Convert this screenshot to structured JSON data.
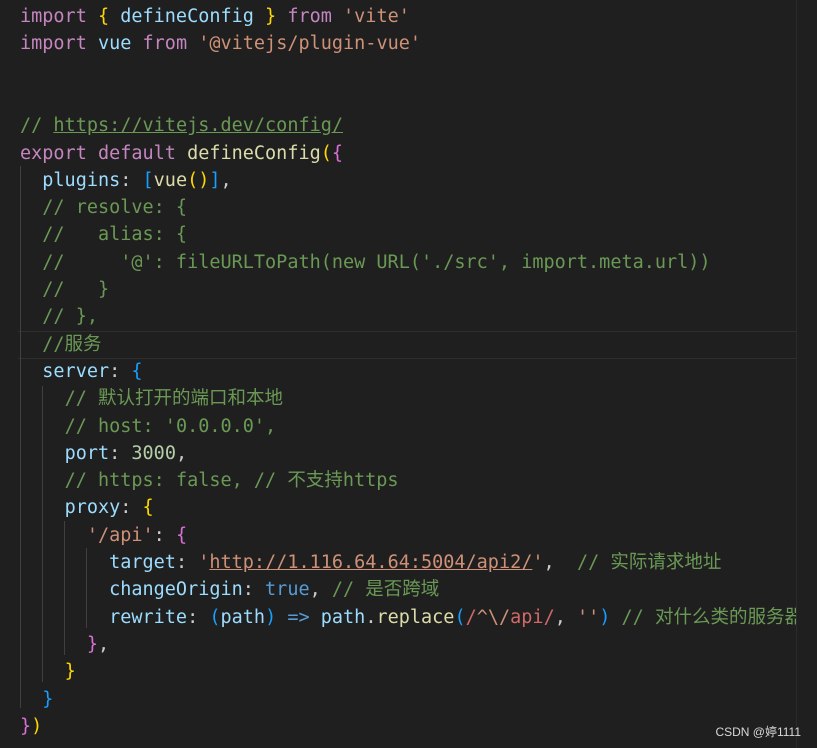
{
  "editor": {
    "lines": [
      [
        {
          "t": "import",
          "c": "kw"
        },
        {
          "t": " "
        },
        {
          "t": "{",
          "c": "b1"
        },
        {
          "t": " defineConfig ",
          "c": "prop"
        },
        {
          "t": "}",
          "c": "b1"
        },
        {
          "t": " "
        },
        {
          "t": "from",
          "c": "kw"
        },
        {
          "t": " "
        },
        {
          "t": "'vite'",
          "c": "str"
        }
      ],
      [
        {
          "t": "import",
          "c": "kw"
        },
        {
          "t": " "
        },
        {
          "t": "vue",
          "c": "prop"
        },
        {
          "t": " "
        },
        {
          "t": "from",
          "c": "kw"
        },
        {
          "t": " "
        },
        {
          "t": "'@vitejs/plugin-vue'",
          "c": "str"
        }
      ],
      [],
      [],
      [
        {
          "t": "// ",
          "c": "cmt"
        },
        {
          "t": "https://vitejs.dev/config/",
          "c": "cmt link"
        }
      ],
      [
        {
          "t": "export",
          "c": "kw"
        },
        {
          "t": " "
        },
        {
          "t": "default",
          "c": "kw"
        },
        {
          "t": " "
        },
        {
          "t": "defineConfig",
          "c": "fn"
        },
        {
          "t": "(",
          "c": "b1"
        },
        {
          "t": "{",
          "c": "b2"
        }
      ],
      [
        {
          "t": "  "
        },
        {
          "t": "plugins",
          "c": "prop"
        },
        {
          "t": ": "
        },
        {
          "t": "[",
          "c": "b3"
        },
        {
          "t": "vue",
          "c": "fn"
        },
        {
          "t": "()",
          "c": "b1"
        },
        {
          "t": "]",
          "c": "b3"
        },
        {
          "t": ","
        }
      ],
      [
        {
          "t": "  "
        },
        {
          "t": "// resolve: {",
          "c": "cmt"
        }
      ],
      [
        {
          "t": "  "
        },
        {
          "t": "//   alias: {",
          "c": "cmt"
        }
      ],
      [
        {
          "t": "  "
        },
        {
          "t": "//     '@': fileURLToPath(new URL('./src', import.meta.url))",
          "c": "cmt"
        }
      ],
      [
        {
          "t": "  "
        },
        {
          "t": "//   }",
          "c": "cmt"
        }
      ],
      [
        {
          "t": "  "
        },
        {
          "t": "// },",
          "c": "cmt"
        }
      ],
      [
        {
          "t": "  "
        },
        {
          "t": "//服务",
          "c": "cmt"
        }
      ],
      [
        {
          "t": "  "
        },
        {
          "t": "server",
          "c": "prop"
        },
        {
          "t": ": "
        },
        {
          "t": "{",
          "c": "b3"
        }
      ],
      [
        {
          "t": "    "
        },
        {
          "t": "// 默认打开的端口和本地",
          "c": "cmt"
        }
      ],
      [
        {
          "t": "    "
        },
        {
          "t": "// host: '0.0.0.0',",
          "c": "cmt"
        }
      ],
      [
        {
          "t": "    "
        },
        {
          "t": "port",
          "c": "prop"
        },
        {
          "t": ": "
        },
        {
          "t": "3000",
          "c": "num"
        },
        {
          "t": ","
        }
      ],
      [
        {
          "t": "    "
        },
        {
          "t": "// https: false, // 不支持https",
          "c": "cmt"
        }
      ],
      [
        {
          "t": "    "
        },
        {
          "t": "proxy",
          "c": "prop"
        },
        {
          "t": ": "
        },
        {
          "t": "{",
          "c": "b1"
        }
      ],
      [
        {
          "t": "      "
        },
        {
          "t": "'/api'",
          "c": "str"
        },
        {
          "t": ": "
        },
        {
          "t": "{",
          "c": "b2"
        }
      ],
      [
        {
          "t": "        "
        },
        {
          "t": "target",
          "c": "prop"
        },
        {
          "t": ": "
        },
        {
          "t": "'",
          "c": "str"
        },
        {
          "t": "http://1.116.64.64:5004/api2/",
          "c": "str link"
        },
        {
          "t": "'",
          "c": "str"
        },
        {
          "t": ",  "
        },
        {
          "t": "// 实际请求地址",
          "c": "cmt"
        }
      ],
      [
        {
          "t": "        "
        },
        {
          "t": "changeOrigin",
          "c": "prop"
        },
        {
          "t": ": "
        },
        {
          "t": "true",
          "c": "kb"
        },
        {
          "t": ", "
        },
        {
          "t": "// 是否跨域",
          "c": "cmt"
        }
      ],
      [
        {
          "t": "        "
        },
        {
          "t": "rewrite",
          "c": "prop"
        },
        {
          "t": ": "
        },
        {
          "t": "(",
          "c": "b3"
        },
        {
          "t": "path",
          "c": "prop"
        },
        {
          "t": ")",
          "c": "b3"
        },
        {
          "t": " "
        },
        {
          "t": "=>",
          "c": "kb"
        },
        {
          "t": " "
        },
        {
          "t": "path",
          "c": "prop"
        },
        {
          "t": "."
        },
        {
          "t": "replace",
          "c": "fn"
        },
        {
          "t": "(",
          "c": "b3"
        },
        {
          "t": "/",
          "c": "rx"
        },
        {
          "t": "^\\/",
          "c": "str"
        },
        {
          "t": "api",
          "c": "rx"
        },
        {
          "t": "/",
          "c": "rx"
        },
        {
          "t": ", "
        },
        {
          "t": "''",
          "c": "str"
        },
        {
          "t": ")",
          "c": "b3"
        },
        {
          "t": " "
        },
        {
          "t": "// 对什么类的服务器",
          "c": "cmt"
        }
      ],
      [
        {
          "t": "      "
        },
        {
          "t": "}",
          "c": "b2"
        },
        {
          "t": ","
        }
      ],
      [
        {
          "t": "    "
        },
        {
          "t": "}",
          "c": "b1"
        }
      ],
      [
        {
          "t": "  "
        },
        {
          "t": "}",
          "c": "b3"
        }
      ],
      [
        {
          "t": "}",
          "c": "b2"
        },
        {
          "t": ")",
          "c": "b1"
        }
      ]
    ]
  },
  "watermark": "CSDN @婷1111"
}
